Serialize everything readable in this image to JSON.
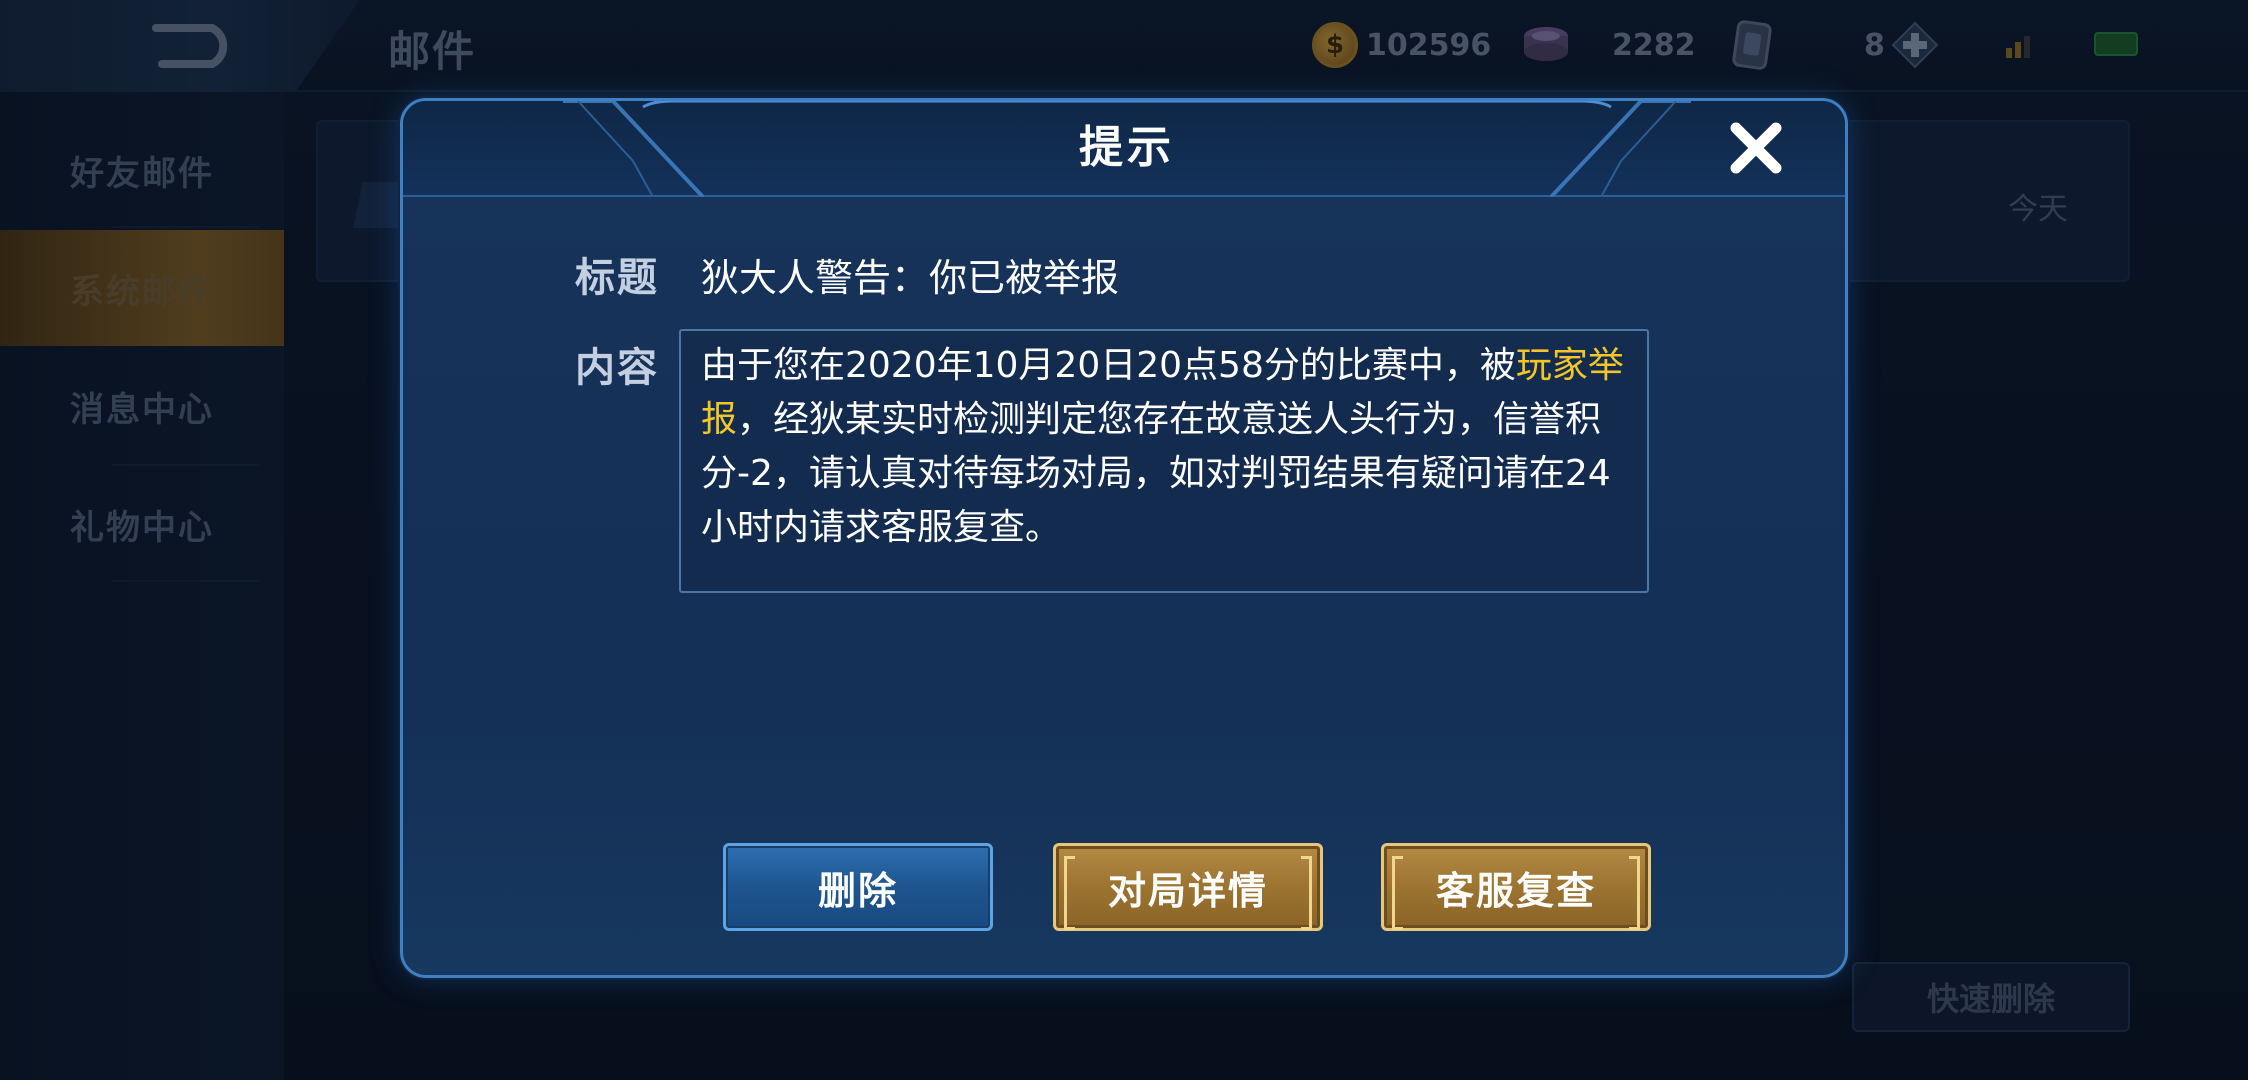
{
  "topbar": {
    "title": "邮件",
    "resources": {
      "coins": "102596",
      "gems": "2282",
      "cards": "8"
    }
  },
  "sidebar": {
    "items": [
      {
        "label": "好友邮件",
        "active": false
      },
      {
        "label": "系统邮件",
        "active": true
      },
      {
        "label": "消息中心",
        "active": false
      },
      {
        "label": "礼物中心",
        "active": false
      }
    ]
  },
  "mail_list": {
    "date": "今天",
    "quick_delete_label": "快速删除"
  },
  "dialog": {
    "title": "提示",
    "title_label": "标题",
    "title_value": "狄大人警告：你已被举报",
    "content_label": "内容",
    "content": {
      "before": "由于您在2020年10月20日20点58分的比赛中，被",
      "highlight": "玩家举报",
      "after": "，经狄某实时检测判定您存在故意送人头行为，信誉积分-2，请认真对待每场对局，如对判罚结果有疑问请在24小时内请求客服复查。"
    },
    "buttons": {
      "delete": "删除",
      "match_detail": "对局详情",
      "service_review": "客服复查"
    }
  },
  "colors": {
    "highlight": "#f2c629",
    "dialog_border": "#3f7fc4",
    "gold_button": "#9c7430",
    "blue_button": "#1d558f"
  }
}
